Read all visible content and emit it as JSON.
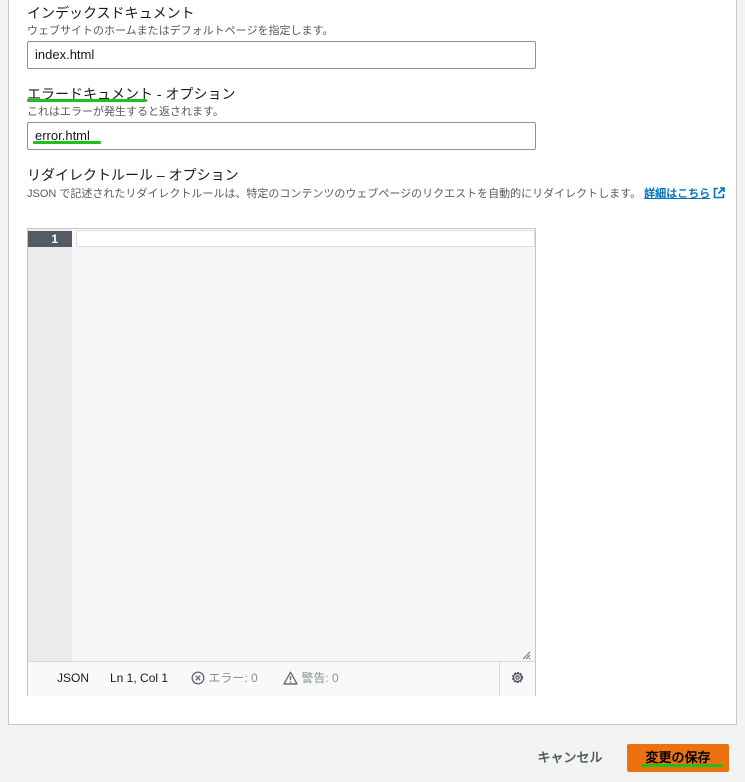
{
  "index_document": {
    "title": "インデックスドキュメント",
    "description": "ウェブサイトのホームまたはデフォルトページを指定します。",
    "value": "index.html"
  },
  "error_document": {
    "title": "エラードキュメント - オプション",
    "description": "これはエラーが発生すると返されます。",
    "value": "error.html"
  },
  "redirect_rules": {
    "title": "リダイレクトルール – オプション",
    "description": "JSON で記述されたリダイレクトルールは、特定のコンテンツのウェブページのリクエストを自動的にリダイレクトします。",
    "learn_more": "詳細はこちら",
    "editor": {
      "line_number": "1",
      "language": "JSON",
      "cursor": "Ln 1, Col 1",
      "errors": "エラー: 0",
      "warnings": "警告: 0"
    }
  },
  "footer": {
    "cancel_label": "キャンセル",
    "save_label": "変更の保存"
  },
  "colors": {
    "primary_button": "#ec7211",
    "link": "#0073bb",
    "annotation_underline": "#1ec01e"
  },
  "icons": [
    "external-link-icon",
    "error-circle-icon",
    "warning-triangle-icon",
    "settings-gear-icon",
    "resize-grip-icon"
  ]
}
